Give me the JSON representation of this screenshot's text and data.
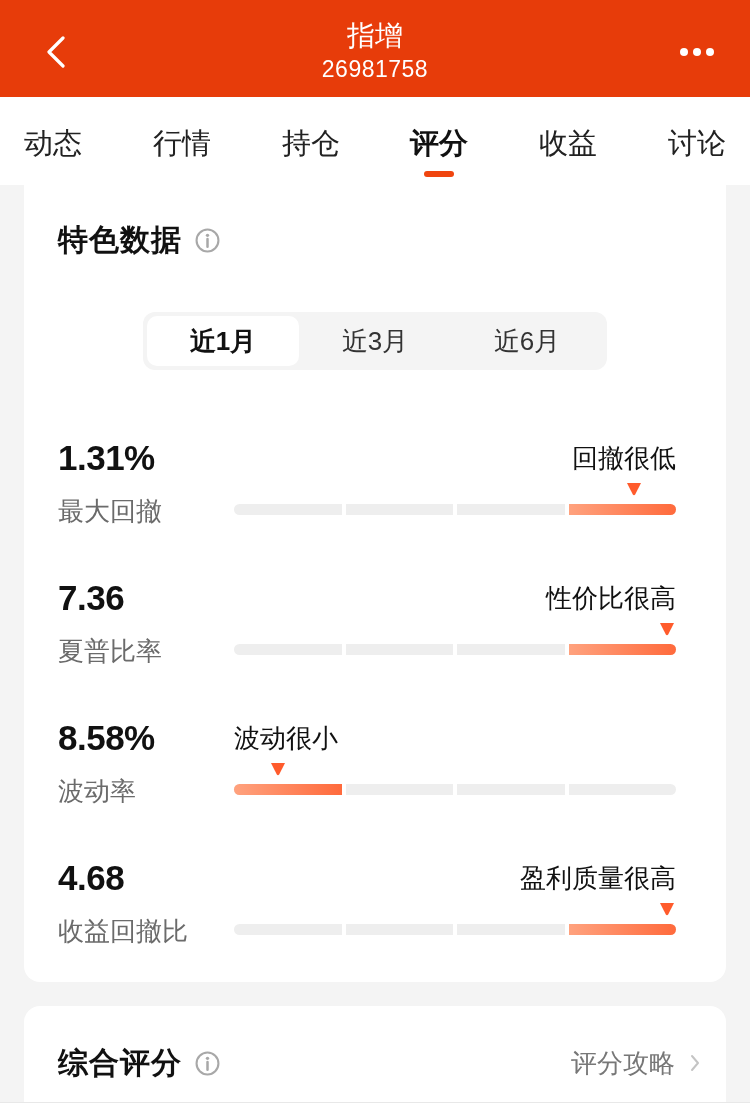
{
  "header": {
    "title": "指增",
    "subtitle": "26981758"
  },
  "tabs": [
    {
      "label": "动态",
      "selected": false
    },
    {
      "label": "行情",
      "selected": false
    },
    {
      "label": "持仓",
      "selected": false
    },
    {
      "label": "评分",
      "selected": true
    },
    {
      "label": "收益",
      "selected": false
    },
    {
      "label": "讨论",
      "selected": false
    }
  ],
  "feature_card": {
    "title": "特色数据",
    "periods": [
      {
        "label": "近1月",
        "selected": true
      },
      {
        "label": "近3月",
        "selected": false
      },
      {
        "label": "近6月",
        "selected": false
      }
    ],
    "metrics": [
      {
        "value": "1.31%",
        "name": "最大回撤",
        "tag": "回撤很低",
        "level": 0.905
      },
      {
        "value": "7.36",
        "name": "夏普比率",
        "tag": "性价比很高",
        "level": 0.98
      },
      {
        "value": "8.58%",
        "name": "波动率",
        "tag": "波动很小",
        "level": 0.1
      },
      {
        "value": "4.68",
        "name": "收益回撤比",
        "tag": "盈利质量很高",
        "level": 0.98
      }
    ]
  },
  "score_card": {
    "title": "综合评分",
    "link": "评分攻略"
  }
}
